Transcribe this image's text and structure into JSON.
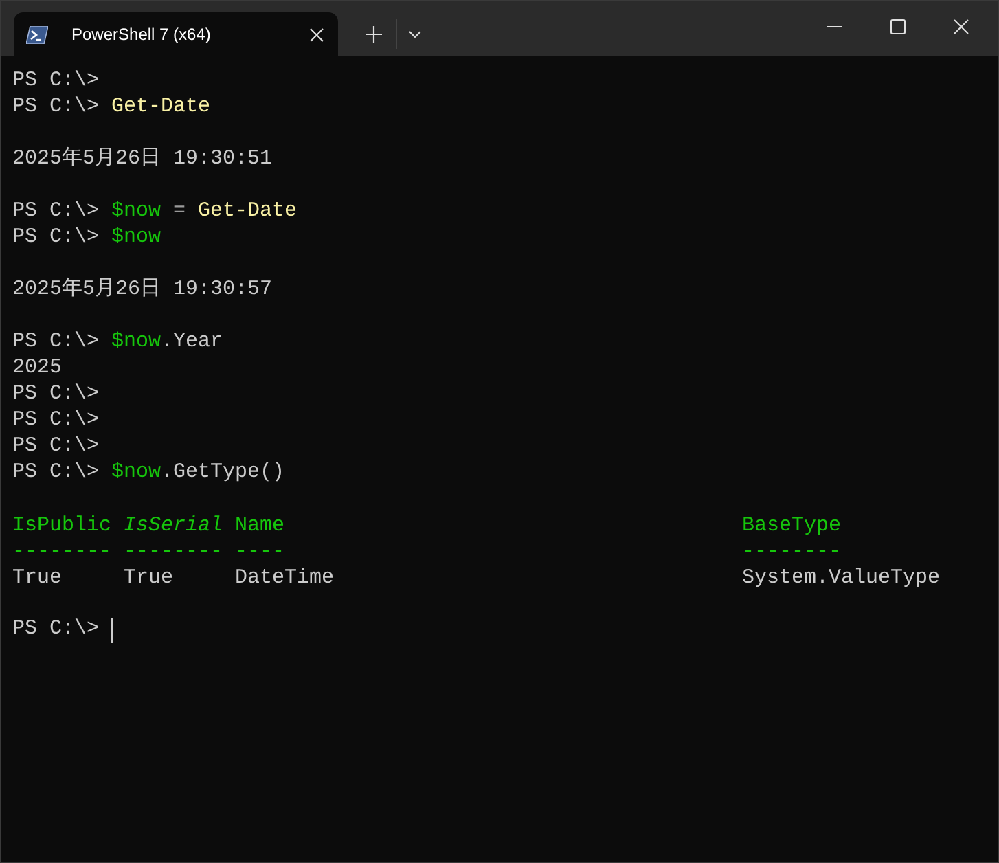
{
  "window": {
    "tab": {
      "title": "PowerShell 7 (x64)",
      "selected": true
    }
  },
  "terminal": {
    "blocks": [
      {
        "kind": "line",
        "segments": [
          {
            "kind": "prompt",
            "text": "PS C:\\>"
          }
        ]
      },
      {
        "kind": "line",
        "segments": [
          {
            "kind": "prompt",
            "text": "PS C:\\>"
          },
          {
            "kind": "command",
            "text": "Get-Date"
          }
        ]
      },
      {
        "kind": "gap"
      },
      {
        "kind": "line",
        "segments": [
          {
            "kind": "output",
            "text": "2025年5月26日 19:30:51"
          }
        ]
      },
      {
        "kind": "gap"
      },
      {
        "kind": "line",
        "segments": [
          {
            "kind": "prompt",
            "text": "PS C:\\>"
          },
          {
            "kind": "variable",
            "text": "$now"
          },
          {
            "kind": "operator",
            "text": "="
          },
          {
            "kind": "command",
            "text": "Get-Date"
          }
        ]
      },
      {
        "kind": "line",
        "segments": [
          {
            "kind": "prompt",
            "text": "PS C:\\>"
          },
          {
            "kind": "variable",
            "text": "$now"
          }
        ]
      },
      {
        "kind": "gap"
      },
      {
        "kind": "line",
        "segments": [
          {
            "kind": "output",
            "text": "2025年5月26日 19:30:57"
          }
        ]
      },
      {
        "kind": "gap"
      },
      {
        "kind": "line",
        "segments": [
          {
            "kind": "prompt",
            "text": "PS C:\\>"
          },
          {
            "kind": "variable",
            "text": "$now"
          },
          {
            "kind": "member",
            "text": ".Year"
          }
        ]
      },
      {
        "kind": "line",
        "segments": [
          {
            "kind": "output",
            "text": "2025"
          }
        ]
      },
      {
        "kind": "line",
        "segments": [
          {
            "kind": "prompt",
            "text": "PS C:\\>"
          }
        ]
      },
      {
        "kind": "line",
        "segments": [
          {
            "kind": "prompt",
            "text": "PS C:\\>"
          }
        ]
      },
      {
        "kind": "line",
        "segments": [
          {
            "kind": "prompt",
            "text": "PS C:\\>"
          }
        ]
      },
      {
        "kind": "line",
        "segments": [
          {
            "kind": "prompt",
            "text": "PS C:\\>"
          },
          {
            "kind": "variable",
            "text": "$now"
          },
          {
            "kind": "member",
            "text": ".GetType()"
          }
        ]
      },
      {
        "kind": "gap"
      },
      {
        "kind": "table",
        "columns": [
          {
            "label": "IsPublic",
            "italic": false,
            "rule": "--------"
          },
          {
            "label": "IsSerial",
            "italic": true,
            "rule": "--------"
          },
          {
            "label": "Name",
            "italic": false,
            "rule": "----"
          },
          {
            "label": "BaseType",
            "italic": false,
            "rule": "--------"
          }
        ],
        "rows": [
          [
            "True",
            "True",
            "DateTime",
            "System.ValueType"
          ]
        ]
      },
      {
        "kind": "gap"
      },
      {
        "kind": "line",
        "cursor": true,
        "segments": [
          {
            "kind": "prompt",
            "text": "PS C:\\>"
          }
        ]
      }
    ]
  }
}
